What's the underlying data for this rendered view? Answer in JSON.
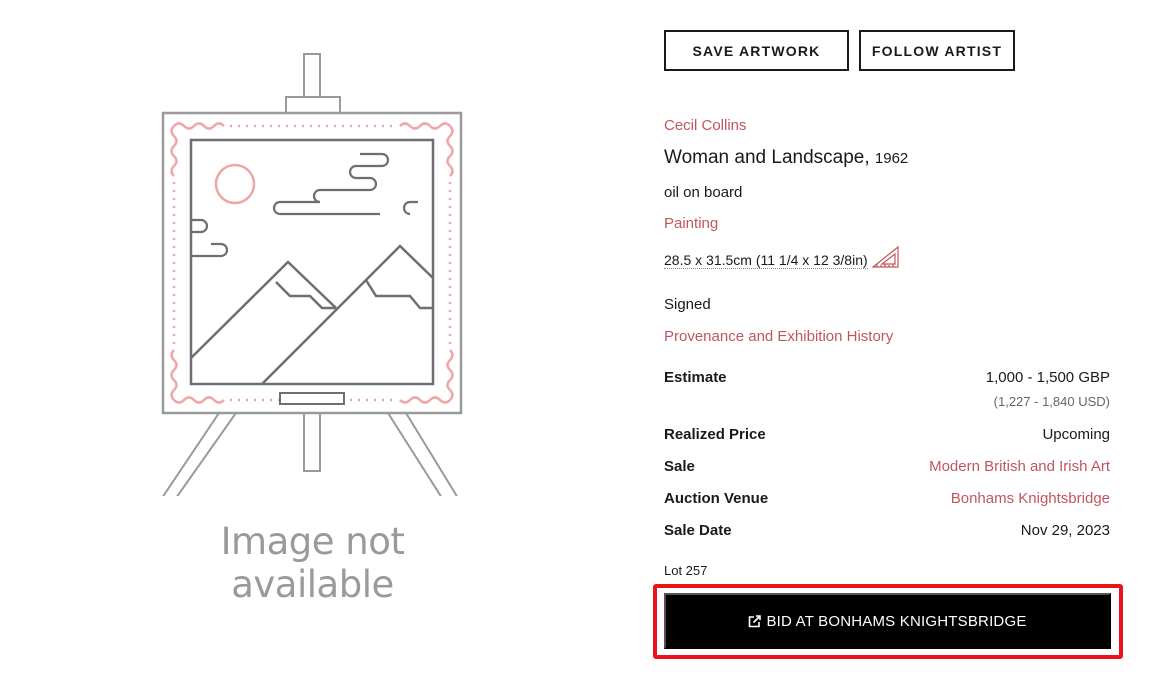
{
  "image": {
    "caption": "Image not available"
  },
  "actions": {
    "save_label": "SAVE ARTWORK",
    "follow_label": "FOLLOW ARTIST"
  },
  "artwork": {
    "artist": "Cecil Collins",
    "title": "Woman and Landscape,",
    "year": "1962",
    "medium": "oil on board",
    "category": "Painting",
    "dimensions": "28.5 x 31.5cm (11 1/4 x 12 3/8in)",
    "signed": "Signed",
    "provenance_link": "Provenance and Exhibition History"
  },
  "details": {
    "estimate_label": "Estimate",
    "estimate_value": "1,000 - 1,500 GBP",
    "estimate_usd": "(1,227 - 1,840 USD)",
    "realized_label": "Realized Price",
    "realized_value": "Upcoming",
    "sale_label": "Sale",
    "sale_value": "Modern British and Irish Art",
    "venue_label": "Auction Venue",
    "venue_value": "Bonhams Knightsbridge",
    "date_label": "Sale Date",
    "date_value": "Nov 29, 2023"
  },
  "lot": "Lot 257",
  "bid": {
    "label": "BID AT BONHAMS KNIGHTSBRIDGE"
  },
  "colors": {
    "accent": "#c0575c",
    "placeholder_pink": "#f0a6a6",
    "placeholder_gray": "#6e6e73",
    "highlight": "#e8141a"
  },
  "icons": {
    "placeholder": "easel-placeholder-icon",
    "dimensions": "ruler-triangle-icon",
    "bid": "external-link-icon"
  }
}
